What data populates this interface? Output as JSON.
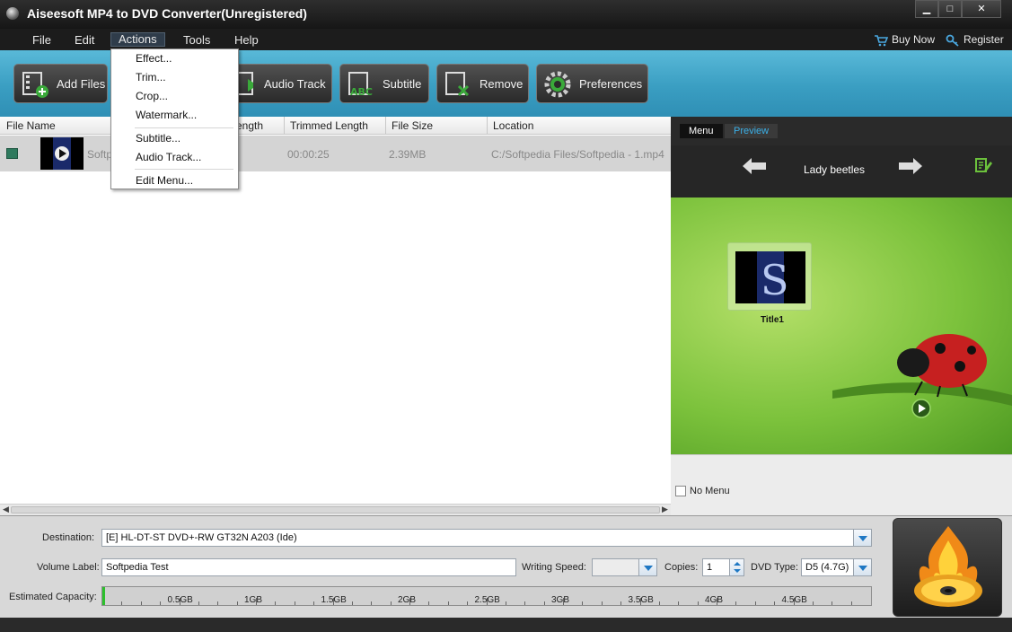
{
  "window": {
    "title": "Aiseesoft MP4 to DVD Converter(Unregistered)",
    "controls": {
      "minimize": "▁",
      "maximize": "□",
      "close": "✕"
    }
  },
  "menubar": {
    "items": [
      "File",
      "Edit",
      "Actions",
      "Tools",
      "Help"
    ],
    "active": "Actions",
    "buy_now": "Buy Now",
    "register": "Register"
  },
  "toolbar": {
    "add_files": "Add Files",
    "audio_track": "Audio Track",
    "subtitle": "Subtitle",
    "remove": "Remove",
    "preferences": "Preferences"
  },
  "actions_menu": {
    "items": [
      "Effect...",
      "Trim...",
      "Crop...",
      "Watermark...",
      "Subtitle...",
      "Audio Track...",
      "Edit Menu..."
    ]
  },
  "file_list": {
    "headers": {
      "file_name": "File Name",
      "length": "ength",
      "trimmed_length": "Trimmed Length",
      "file_size": "File Size",
      "location": "Location"
    },
    "rows": [
      {
        "name": "Softp",
        "trimmed_length": "00:00:25",
        "file_size": "2.39MB",
        "location": "C:/Softpedia Files/Softpedia - 1.mp4"
      }
    ]
  },
  "preview": {
    "tab_menu": "Menu",
    "tab_preview": "Preview",
    "template_name": "Lady beetles",
    "title_label": "Title1",
    "no_menu_label": "No Menu"
  },
  "bottom": {
    "destination_label": "Destination:",
    "destination_value": "[E] HL-DT-ST DVD+-RW GT32N A203 (Ide)",
    "volume_label": "Volume Label:",
    "volume_value": "Softpedia Test",
    "writing_speed_label": "Writing Speed:",
    "writing_speed_value": "",
    "copies_label": "Copies:",
    "copies_value": "1",
    "dvd_type_label": "DVD Type:",
    "dvd_type_value": "D5 (4.7G)",
    "capacity_label": "Estimated Capacity:",
    "capacity_ticks": [
      "0.5GB",
      "1GB",
      "1.5GB",
      "2GB",
      "2.5GB",
      "3GB",
      "3.5GB",
      "4GB",
      "4.5GB"
    ]
  },
  "colors": {
    "toolbar_gradient_top": "#59b9d8",
    "toolbar_gradient_bottom": "#2f8fb5",
    "accent_blue": "#1f78c4",
    "capacity_fill": "#2cc02c"
  }
}
